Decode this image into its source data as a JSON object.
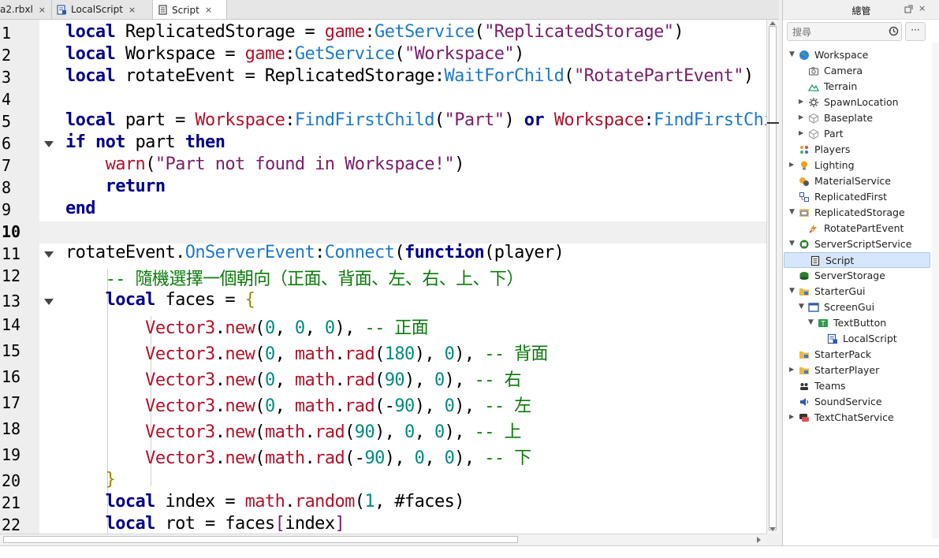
{
  "tabs": [
    {
      "label": "a2.rbxl",
      "close": "×",
      "icon": "place-file-icon"
    },
    {
      "label": "LocalScript",
      "close": "×",
      "icon": "local-script-icon"
    },
    {
      "label": "Script",
      "close": "×",
      "icon": "script-icon"
    }
  ],
  "editor": {
    "line_numbers": [
      "1",
      "2",
      "3",
      "4",
      "5",
      "6",
      "7",
      "8",
      "9",
      "10",
      "11",
      "12",
      "13",
      "14",
      "15",
      "16",
      "17",
      "18",
      "19",
      "20",
      "21",
      "22"
    ],
    "current_line": "10",
    "lines": [
      [
        [
          "kw",
          "local"
        ],
        [
          "t",
          " ReplicatedStorage = "
        ],
        [
          "gbl",
          "game"
        ],
        [
          "t",
          ":"
        ],
        [
          "mth",
          "GetService"
        ],
        [
          "t",
          "("
        ],
        [
          "str",
          "\"ReplicatedStorage\""
        ],
        [
          "t",
          ")"
        ]
      ],
      [
        [
          "kw",
          "local"
        ],
        [
          "t",
          " Workspace = "
        ],
        [
          "gbl",
          "game"
        ],
        [
          "t",
          ":"
        ],
        [
          "mth",
          "GetService"
        ],
        [
          "t",
          "("
        ],
        [
          "str",
          "\"Workspace\""
        ],
        [
          "t",
          ")"
        ]
      ],
      [
        [
          "kw",
          "local"
        ],
        [
          "t",
          " rotateEvent = ReplicatedStorage:"
        ],
        [
          "mth",
          "WaitForChild"
        ],
        [
          "t",
          "("
        ],
        [
          "str",
          "\"RotatePartEvent\""
        ],
        [
          "t",
          ")"
        ]
      ],
      [],
      [
        [
          "kw",
          "local"
        ],
        [
          "t",
          " part = "
        ],
        [
          "gbl",
          "Workspace"
        ],
        [
          "t",
          ":"
        ],
        [
          "mth",
          "FindFirstChild"
        ],
        [
          "t",
          "("
        ],
        [
          "str",
          "\"Part\""
        ],
        [
          "t",
          ") "
        ],
        [
          "kw",
          "or"
        ],
        [
          "t",
          " "
        ],
        [
          "gbl",
          "Workspace"
        ],
        [
          "t",
          ":"
        ],
        [
          "mth",
          "FindFirstChild"
        ],
        [
          "t",
          "("
        ]
      ],
      [
        [
          "kw",
          "if"
        ],
        [
          "t",
          " "
        ],
        [
          "kw",
          "not"
        ],
        [
          "t",
          " part "
        ],
        [
          "kw",
          "then"
        ]
      ],
      [
        [
          "t",
          "    "
        ],
        [
          "gbl",
          "warn"
        ],
        [
          "t",
          "("
        ],
        [
          "str",
          "\"Part not found in Workspace!\""
        ],
        [
          "t",
          ")"
        ]
      ],
      [
        [
          "t",
          "    "
        ],
        [
          "kw",
          "return"
        ]
      ],
      [
        [
          "kw",
          "end"
        ]
      ],
      [],
      [
        [
          "t",
          "rotateEvent."
        ],
        [
          "mth",
          "OnServerEvent"
        ],
        [
          "t",
          ":"
        ],
        [
          "mth",
          "Connect"
        ],
        [
          "t",
          "("
        ],
        [
          "kw",
          "function"
        ],
        [
          "t",
          "(player)"
        ]
      ],
      [
        [
          "t",
          "    "
        ],
        [
          "cm",
          "-- 隨機選擇一個朝向（正面、背面、左、右、上、下）"
        ]
      ],
      [
        [
          "t",
          "    "
        ],
        [
          "kw",
          "local"
        ],
        [
          "t",
          " faces = "
        ],
        [
          "brc",
          "{"
        ]
      ],
      [
        [
          "t",
          "        "
        ],
        [
          "gbl",
          "Vector3"
        ],
        [
          "t",
          "."
        ],
        [
          "gbl",
          "new"
        ],
        [
          "t",
          "("
        ],
        [
          "num",
          "0"
        ],
        [
          "t",
          ", "
        ],
        [
          "num",
          "0"
        ],
        [
          "t",
          ", "
        ],
        [
          "num",
          "0"
        ],
        [
          "t",
          "), "
        ],
        [
          "cm",
          "-- 正面"
        ]
      ],
      [
        [
          "t",
          "        "
        ],
        [
          "gbl",
          "Vector3"
        ],
        [
          "t",
          "."
        ],
        [
          "gbl",
          "new"
        ],
        [
          "t",
          "("
        ],
        [
          "num",
          "0"
        ],
        [
          "t",
          ", "
        ],
        [
          "gbl",
          "math"
        ],
        [
          "t",
          "."
        ],
        [
          "gbl",
          "rad"
        ],
        [
          "t",
          "("
        ],
        [
          "num",
          "180"
        ],
        [
          "t",
          "), "
        ],
        [
          "num",
          "0"
        ],
        [
          "t",
          "), "
        ],
        [
          "cm",
          "-- 背面"
        ]
      ],
      [
        [
          "t",
          "        "
        ],
        [
          "gbl",
          "Vector3"
        ],
        [
          "t",
          "."
        ],
        [
          "gbl",
          "new"
        ],
        [
          "t",
          "("
        ],
        [
          "num",
          "0"
        ],
        [
          "t",
          ", "
        ],
        [
          "gbl",
          "math"
        ],
        [
          "t",
          "."
        ],
        [
          "gbl",
          "rad"
        ],
        [
          "t",
          "("
        ],
        [
          "num",
          "90"
        ],
        [
          "t",
          "), "
        ],
        [
          "num",
          "0"
        ],
        [
          "t",
          "), "
        ],
        [
          "cm",
          "-- 右"
        ]
      ],
      [
        [
          "t",
          "        "
        ],
        [
          "gbl",
          "Vector3"
        ],
        [
          "t",
          "."
        ],
        [
          "gbl",
          "new"
        ],
        [
          "t",
          "("
        ],
        [
          "num",
          "0"
        ],
        [
          "t",
          ", "
        ],
        [
          "gbl",
          "math"
        ],
        [
          "t",
          "."
        ],
        [
          "gbl",
          "rad"
        ],
        [
          "t",
          "(-"
        ],
        [
          "num",
          "90"
        ],
        [
          "t",
          "), "
        ],
        [
          "num",
          "0"
        ],
        [
          "t",
          "), "
        ],
        [
          "cm",
          "-- 左"
        ]
      ],
      [
        [
          "t",
          "        "
        ],
        [
          "gbl",
          "Vector3"
        ],
        [
          "t",
          "."
        ],
        [
          "gbl",
          "new"
        ],
        [
          "t",
          "("
        ],
        [
          "gbl",
          "math"
        ],
        [
          "t",
          "."
        ],
        [
          "gbl",
          "rad"
        ],
        [
          "t",
          "("
        ],
        [
          "num",
          "90"
        ],
        [
          "t",
          "), "
        ],
        [
          "num",
          "0"
        ],
        [
          "t",
          ", "
        ],
        [
          "num",
          "0"
        ],
        [
          "t",
          "), "
        ],
        [
          "cm",
          "-- 上"
        ]
      ],
      [
        [
          "t",
          "        "
        ],
        [
          "gbl",
          "Vector3"
        ],
        [
          "t",
          "."
        ],
        [
          "gbl",
          "new"
        ],
        [
          "t",
          "("
        ],
        [
          "gbl",
          "math"
        ],
        [
          "t",
          "."
        ],
        [
          "gbl",
          "rad"
        ],
        [
          "t",
          "(-"
        ],
        [
          "num",
          "90"
        ],
        [
          "t",
          "), "
        ],
        [
          "num",
          "0"
        ],
        [
          "t",
          ", "
        ],
        [
          "num",
          "0"
        ],
        [
          "t",
          "), "
        ],
        [
          "cm",
          "-- 下"
        ]
      ],
      [
        [
          "t",
          "    "
        ],
        [
          "brc",
          "}"
        ]
      ],
      [
        [
          "t",
          "    "
        ],
        [
          "kw",
          "local"
        ],
        [
          "t",
          " index = "
        ],
        [
          "gbl",
          "math"
        ],
        [
          "t",
          "."
        ],
        [
          "gbl",
          "random"
        ],
        [
          "t",
          "("
        ],
        [
          "num",
          "1"
        ],
        [
          "t",
          ", #faces)"
        ]
      ],
      [
        [
          "t",
          "    "
        ],
        [
          "kw",
          "local"
        ],
        [
          "t",
          " rot = faces"
        ],
        [
          "brc2",
          "["
        ],
        [
          "t",
          "index"
        ],
        [
          "brc2",
          "]"
        ]
      ]
    ]
  },
  "explorer": {
    "title": "總管",
    "search_placeholder": "搜尋",
    "more_label": "···",
    "items": [
      {
        "label": "Workspace",
        "depth": 0,
        "arrow": "open",
        "icon": "globe-icon"
      },
      {
        "label": "Camera",
        "depth": 1,
        "arrow": "none",
        "icon": "camera-icon"
      },
      {
        "label": "Terrain",
        "depth": 1,
        "arrow": "none",
        "icon": "terrain-icon"
      },
      {
        "label": "SpawnLocation",
        "depth": 1,
        "arrow": "closed",
        "icon": "spawn-icon"
      },
      {
        "label": "Baseplate",
        "depth": 1,
        "arrow": "closed",
        "icon": "part-icon"
      },
      {
        "label": "Part",
        "depth": 1,
        "arrow": "closed",
        "icon": "part-icon"
      },
      {
        "label": "Players",
        "depth": 0,
        "arrow": "none",
        "icon": "players-icon"
      },
      {
        "label": "Lighting",
        "depth": 0,
        "arrow": "closed",
        "icon": "lightbulb-icon"
      },
      {
        "label": "MaterialService",
        "depth": 0,
        "arrow": "none",
        "icon": "material-service-icon"
      },
      {
        "label": "ReplicatedFirst",
        "depth": 0,
        "arrow": "none",
        "icon": "replicated-first-icon"
      },
      {
        "label": "ReplicatedStorage",
        "depth": 0,
        "arrow": "open",
        "icon": "replicated-storage-icon"
      },
      {
        "label": "RotatePartEvent",
        "depth": 1,
        "arrow": "none",
        "icon": "remote-event-icon"
      },
      {
        "label": "ServerScriptService",
        "depth": 0,
        "arrow": "open",
        "icon": "server-script-service-icon"
      },
      {
        "label": "Script",
        "depth": 1,
        "arrow": "none",
        "icon": "script-icon",
        "selected": true
      },
      {
        "label": "ServerStorage",
        "depth": 0,
        "arrow": "none",
        "icon": "server-storage-icon"
      },
      {
        "label": "StarterGui",
        "depth": 0,
        "arrow": "open",
        "icon": "folder-icon"
      },
      {
        "label": "ScreenGui",
        "depth": 1,
        "arrow": "open",
        "icon": "screengui-icon"
      },
      {
        "label": "TextButton",
        "depth": 2,
        "arrow": "open",
        "icon": "textbutton-icon"
      },
      {
        "label": "LocalScript",
        "depth": 3,
        "arrow": "none",
        "icon": "local-script-icon"
      },
      {
        "label": "StarterPack",
        "depth": 0,
        "arrow": "none",
        "icon": "folder-icon"
      },
      {
        "label": "StarterPlayer",
        "depth": 0,
        "arrow": "closed",
        "icon": "folder-icon"
      },
      {
        "label": "Teams",
        "depth": 0,
        "arrow": "none",
        "icon": "teams-icon"
      },
      {
        "label": "SoundService",
        "depth": 0,
        "arrow": "none",
        "icon": "sound-icon"
      },
      {
        "label": "TextChatService",
        "depth": 0,
        "arrow": "closed",
        "icon": "chat-icon"
      }
    ]
  }
}
